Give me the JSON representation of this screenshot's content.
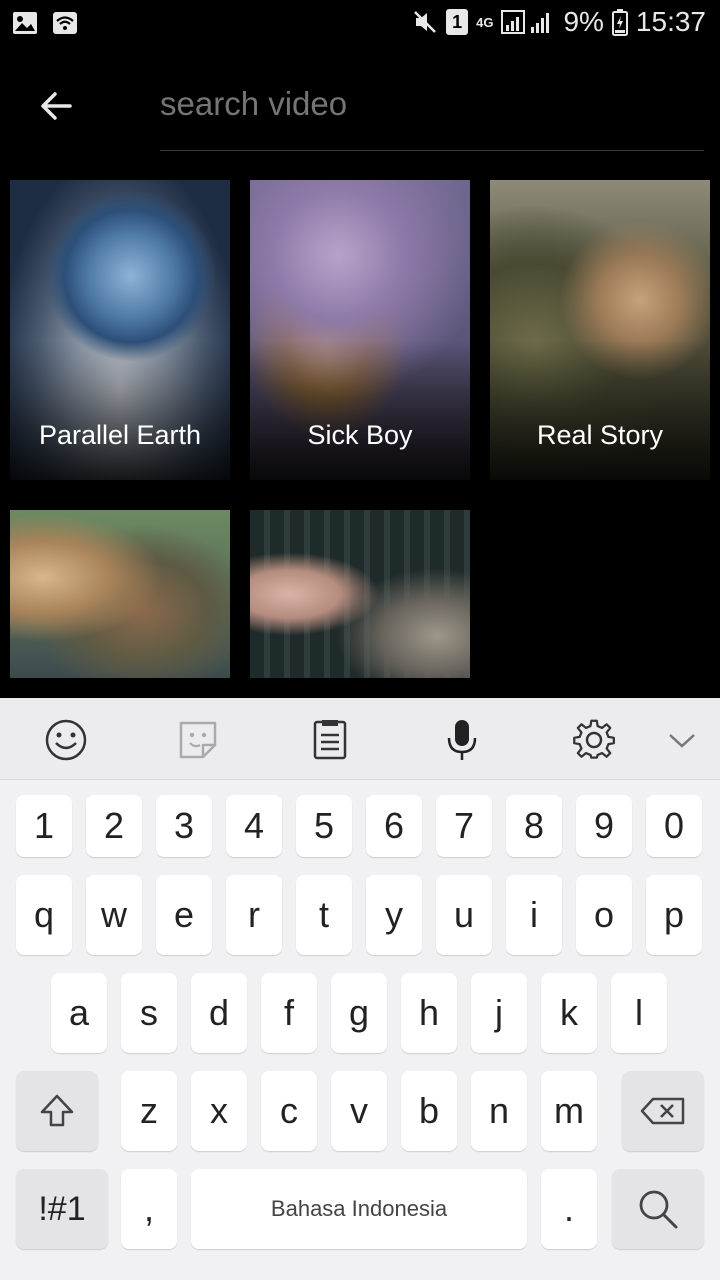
{
  "status_bar": {
    "battery": "9%",
    "time": "15:37",
    "network_type": "4G",
    "sim_slot": "1",
    "icons": [
      "image-icon",
      "wifi-icon",
      "mute-icon",
      "sim-icon",
      "signal-icon",
      "battery-icon"
    ]
  },
  "search": {
    "placeholder": "search video",
    "value": ""
  },
  "videos": [
    {
      "title": "Parallel Earth"
    },
    {
      "title": "Sick Boy"
    },
    {
      "title": "Real Story"
    },
    {
      "title": ""
    },
    {
      "title": ""
    }
  ],
  "keyboard": {
    "toolbar_icons": [
      "emoji-icon",
      "sticker-icon",
      "clipboard-icon",
      "microphone-icon",
      "settings-icon",
      "collapse-icon"
    ],
    "number_row": [
      "1",
      "2",
      "3",
      "4",
      "5",
      "6",
      "7",
      "8",
      "9",
      "0"
    ],
    "row1": [
      "q",
      "w",
      "e",
      "r",
      "t",
      "y",
      "u",
      "i",
      "o",
      "p"
    ],
    "row2": [
      "a",
      "s",
      "d",
      "f",
      "g",
      "h",
      "j",
      "k",
      "l"
    ],
    "row3": [
      "z",
      "x",
      "c",
      "v",
      "b",
      "n",
      "m"
    ],
    "symbols_label": "!#1",
    "comma_label": ",",
    "space_label": "Bahasa Indonesia",
    "period_label": "."
  }
}
